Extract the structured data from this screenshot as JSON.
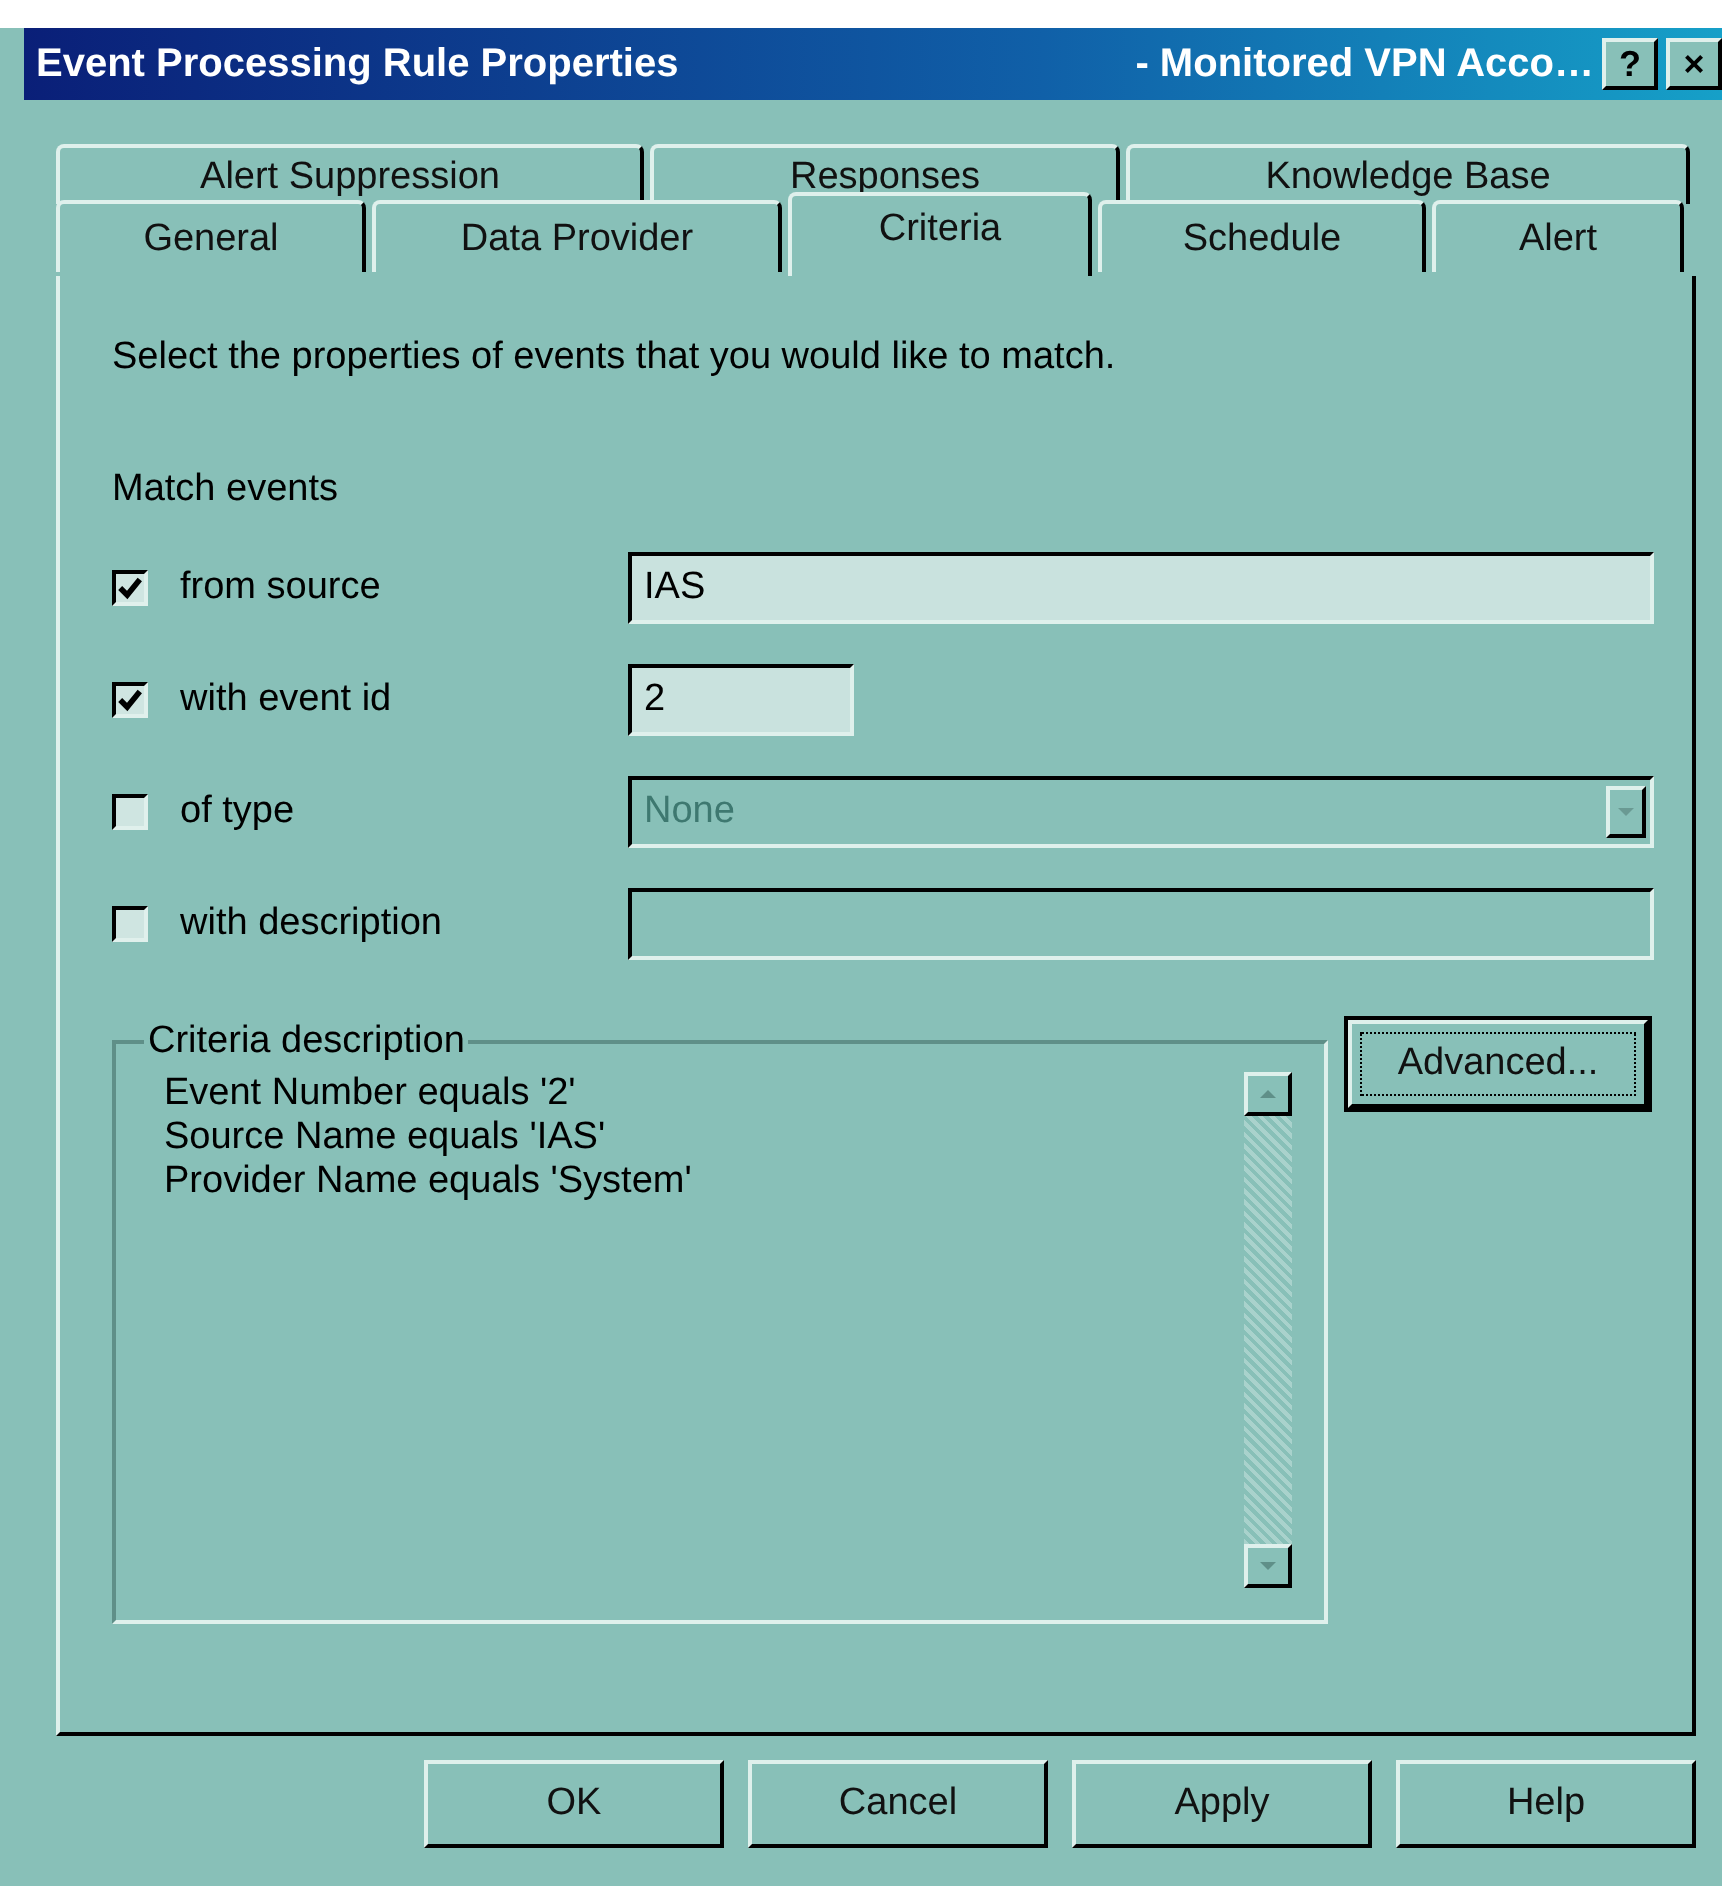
{
  "window": {
    "title": "Event Processing Rule Properties",
    "subtitle": "- Monitored VPN Acco…",
    "help_button": "?",
    "close_button": "×"
  },
  "tab_rows": [
    [
      {
        "label": "Alert Suppression",
        "selected": false
      },
      {
        "label": "Responses",
        "selected": false
      },
      {
        "label": "Knowledge Base",
        "selected": false
      }
    ],
    [
      {
        "label": "General",
        "selected": false
      },
      {
        "label": "Data Provider",
        "selected": false
      },
      {
        "label": "Criteria",
        "selected": true
      },
      {
        "label": "Schedule",
        "selected": false
      },
      {
        "label": "Alert",
        "selected": false
      }
    ]
  ],
  "intro": "Select the properties of events that you would like to match.",
  "match_label": "Match events",
  "criteria": [
    {
      "label": "from source",
      "checked": true,
      "kind": "text",
      "value": "IAS",
      "disabled": false
    },
    {
      "label": "with event id",
      "checked": true,
      "kind": "text",
      "value": "2",
      "disabled": false
    },
    {
      "label": "of type",
      "checked": false,
      "kind": "dropdown",
      "value": "None",
      "disabled": true
    },
    {
      "label": "with description",
      "checked": false,
      "kind": "text",
      "disabled": true
    }
  ],
  "criteria_description": {
    "title": "Criteria description",
    "lines": [
      "Event Number equals '2'",
      "Source Name equals 'IAS'",
      "Provider Name equals 'System'"
    ]
  },
  "advanced_button": "Advanced...",
  "buttons": [
    "OK",
    "Cancel",
    "Apply",
    "Help"
  ]
}
